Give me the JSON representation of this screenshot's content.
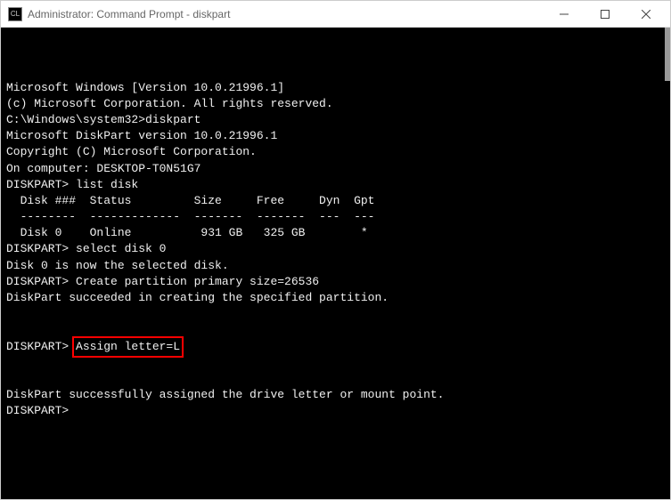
{
  "titlebar": {
    "label": "Administrator: Command Prompt - diskpart",
    "icon": "CL"
  },
  "terminal": {
    "lines": [
      "Microsoft Windows [Version 10.0.21996.1]",
      "(c) Microsoft Corporation. All rights reserved.",
      "",
      "C:\\Windows\\system32>diskpart",
      "",
      "Microsoft DiskPart version 10.0.21996.1",
      "",
      "Copyright (C) Microsoft Corporation.",
      "On computer: DESKTOP-T0N51G7",
      "",
      "DISKPART> list disk",
      "",
      "  Disk ###  Status         Size     Free     Dyn  Gpt",
      "  --------  -------------  -------  -------  ---  ---",
      "  Disk 0    Online          931 GB   325 GB        *",
      "",
      "DISKPART> select disk 0",
      "",
      "Disk 0 is now the selected disk.",
      "",
      "DISKPART> Create partition primary size=26536",
      "",
      "DiskPart succeeded in creating the specified partition.",
      ""
    ],
    "highlighted_prompt": "DISKPART> ",
    "highlighted_command": "Assign letter=L",
    "after_lines": [
      "",
      "DiskPart successfully assigned the drive letter or mount point.",
      "",
      "DISKPART>"
    ]
  }
}
